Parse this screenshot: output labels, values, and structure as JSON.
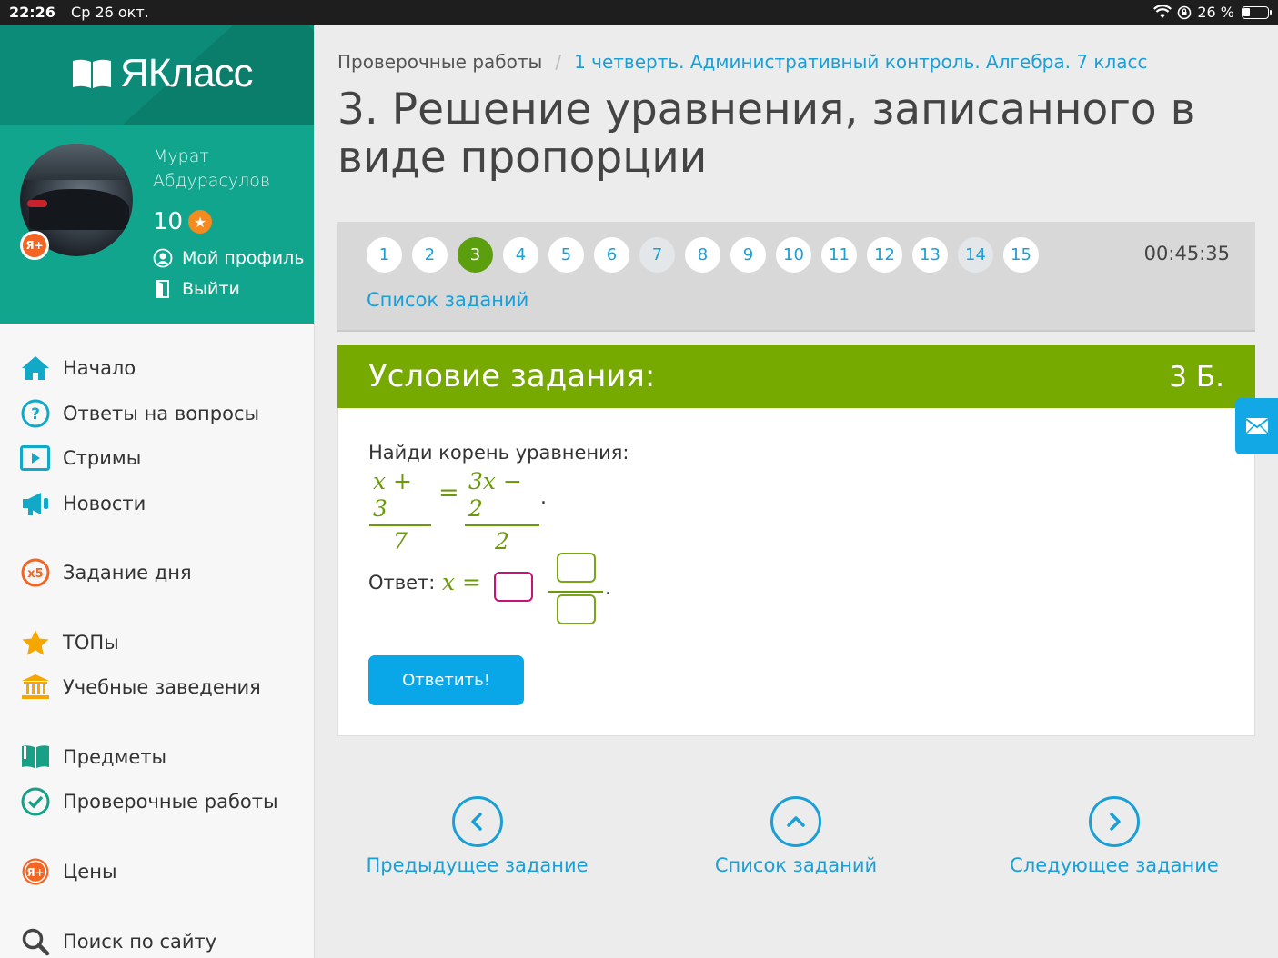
{
  "statusbar": {
    "time": "22:26",
    "date": "Ср 26 окт.",
    "battery": "26 %",
    "battery_level": 0.26
  },
  "logo": {
    "text": "ЯКласс"
  },
  "profile": {
    "name": "Мурат Абдурасулов",
    "points": "10",
    "badge": "Я+",
    "my_profile": "Мой профиль",
    "logout": "Выйти"
  },
  "nav": [
    {
      "label": "Начало",
      "icon": "home-icon"
    },
    {
      "label": "Ответы на вопросы",
      "icon": "question-icon"
    },
    {
      "label": "Стримы",
      "icon": "play-icon"
    },
    {
      "label": "Новости",
      "icon": "megaphone-icon"
    },
    {
      "label": "Задание дня",
      "icon": "x5-icon",
      "icon_text": "x5"
    },
    {
      "label": "ТОПы",
      "icon": "star-icon"
    },
    {
      "label": "Учебные заведения",
      "icon": "school-icon"
    },
    {
      "label": "Предметы",
      "icon": "book-icon"
    },
    {
      "label": "Проверочные работы",
      "icon": "check-icon"
    },
    {
      "label": "Цены",
      "icon": "yaplus-icon",
      "icon_text": "Я+"
    },
    {
      "label": "Поиск по сайту",
      "icon": "search-icon"
    }
  ],
  "breadcrumb": {
    "root": "Проверочные работы",
    "separator": "/",
    "current": "1 четверть. Административный контроль. Алгебра. 7 класс"
  },
  "page_title": "3. Решение уравнения, записанного в виде пропорции",
  "tasks": {
    "numbers": [
      "1",
      "2",
      "3",
      "4",
      "5",
      "6",
      "7",
      "8",
      "9",
      "10",
      "11",
      "12",
      "13",
      "14",
      "15"
    ],
    "active": "3",
    "done": [
      "7",
      "14"
    ],
    "timer": "00:45:35",
    "list_link": "Список заданий"
  },
  "condition": {
    "title": "Условие задания:",
    "score": "3 Б.",
    "prompt": "Найди корень уравнения:",
    "lhs_num": "x + 3",
    "lhs_den": "7",
    "equals": "=",
    "rhs_num": "3x − 2",
    "rhs_den": "2",
    "period": ".",
    "answer_label": "Ответ:",
    "answer_var": "x =",
    "submit": "Ответить!"
  },
  "bottom_nav": {
    "prev": "Предыдущее задание",
    "list": "Список заданий",
    "next": "Следующее задание"
  },
  "colors": {
    "teal_dark": "#0c8c78",
    "teal": "#12a58d",
    "green": "#76aa00",
    "blue": "#1a9fd6",
    "button": "#0aa7e8",
    "orange": "#f26522"
  }
}
